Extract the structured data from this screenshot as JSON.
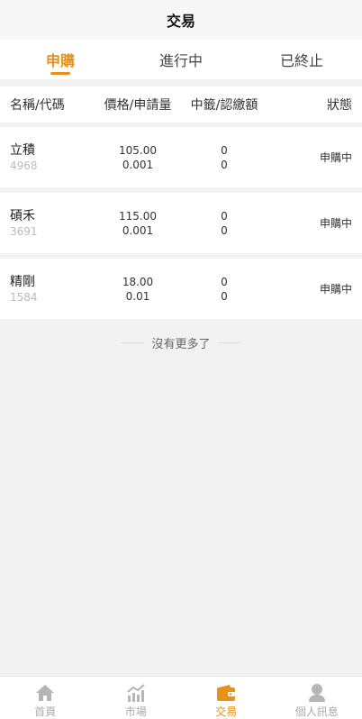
{
  "header": {
    "title": "交易"
  },
  "tabs": [
    {
      "label": "申購",
      "active": true
    },
    {
      "label": "進行中",
      "active": false
    },
    {
      "label": "已終止",
      "active": false
    }
  ],
  "columns": {
    "name_code": "名稱/代碼",
    "price_qty": "價格/申請量",
    "win_paid": "中籤/認繳額",
    "status": "狀態"
  },
  "rows": [
    {
      "name": "立積",
      "code": "4968",
      "price": "105.00",
      "qty": "0.001",
      "win": "0",
      "paid": "0",
      "status": "申購中"
    },
    {
      "name": "碩禾",
      "code": "3691",
      "price": "115.00",
      "qty": "0.001",
      "win": "0",
      "paid": "0",
      "status": "申購中"
    },
    {
      "name": "精剛",
      "code": "1584",
      "price": "18.00",
      "qty": "0.01",
      "win": "0",
      "paid": "0",
      "status": "申購中"
    }
  ],
  "list_footer": "沒有更多了",
  "bottom_nav": [
    {
      "label": "首頁",
      "icon": "home-icon",
      "active": false
    },
    {
      "label": "市場",
      "icon": "chart-icon",
      "active": false
    },
    {
      "label": "交易",
      "icon": "wallet-icon",
      "active": true
    },
    {
      "label": "個人訊息",
      "icon": "user-icon",
      "active": false
    }
  ],
  "colors": {
    "accent": "#e8901c",
    "inactive": "#aaaaaa",
    "background": "#f2f2f2"
  }
}
